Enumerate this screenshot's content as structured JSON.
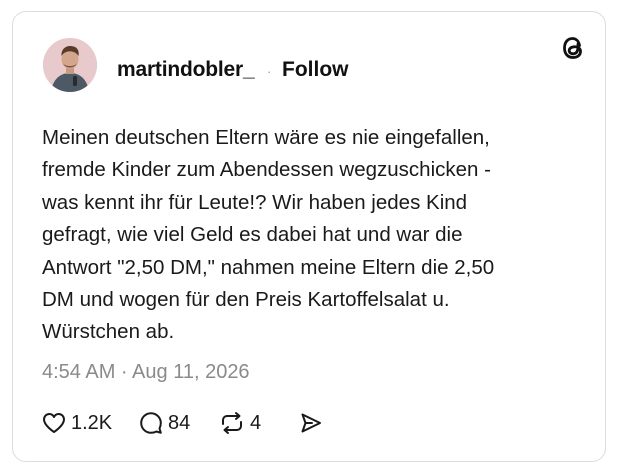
{
  "post": {
    "username": "martindobler_",
    "separator": "·",
    "follow_label": "Follow",
    "text": "Meinen deutschen Eltern wäre es nie eingefallen,\nfremde Kinder zum Abendessen wegzuschicken -\nwas kennt ihr für Leute!? Wir haben jedes Kind\ngefragt, wie viel Geld es dabei hat und war die\nAntwort \"2,50 DM,\" nahmen meine Eltern die 2,50\nDM und wogen für den Preis Kartoffelsalat u.\nWürstchen ab.",
    "timestamp": "4:54 AM · Aug 11, 2026"
  },
  "actions": {
    "likes": "1.2K",
    "comments": "84",
    "reposts": "4"
  },
  "icons": {
    "brand": "threads-logo-icon",
    "like": "heart-icon",
    "comment": "speech-bubble-icon",
    "repost": "repost-arrows-icon",
    "share": "send-icon"
  },
  "colors": {
    "text": "#1a1a1a",
    "muted": "#8a8a8a",
    "border": "#dcdcdc",
    "avatar_bg": "#e8c9cc"
  }
}
